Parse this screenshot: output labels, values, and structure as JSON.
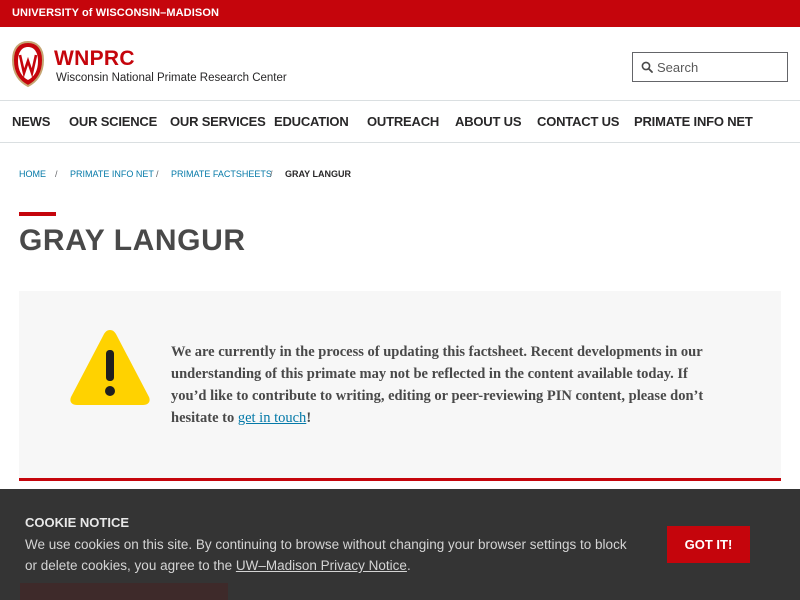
{
  "topbar": {
    "university_label": "UNIVERSITY of WISCONSIN–MADISON"
  },
  "header": {
    "site_acronym": "WNPRC",
    "site_name": "Wisconsin National Primate Research Center",
    "search_placeholder": "Search"
  },
  "nav": {
    "items": [
      {
        "label": "NEWS"
      },
      {
        "label": "OUR SCIENCE"
      },
      {
        "label": "OUR SERVICES"
      },
      {
        "label": "EDUCATION"
      },
      {
        "label": "OUTREACH"
      },
      {
        "label": "ABOUT US"
      },
      {
        "label": "CONTACT US"
      },
      {
        "label": "PRIMATE INFO NET"
      }
    ]
  },
  "breadcrumb": {
    "items": [
      "HOME",
      "PRIMATE INFO NET",
      "PRIMATE FACTSHEETS"
    ],
    "separator": "/",
    "current": "GRAY LANGUR"
  },
  "page": {
    "title": "GRAY LANGUR"
  },
  "notice": {
    "text_before_link": "We are currently in the process of updating this factsheet. Recent developments in our understanding of this primate may not be reflected in the content available today. If you’d like to contribute to writing, editing or peer-reviewing PIN content, please don’t hesitate to ",
    "link_text": "get in touch",
    "text_after_link": "!",
    "icon": "warning-icon"
  },
  "cookie": {
    "title": "COOKIE NOTICE",
    "body_before_link": "We use cookies on this site. By continuing to browse without changing your browser settings to block or delete cookies, you agree to the ",
    "link_text": "UW–Madison Privacy Notice",
    "body_after_link": ".",
    "button_label": "GOT IT!"
  },
  "colors": {
    "brand_red": "#c5050c",
    "link_blue": "#0479a8",
    "warning_yellow": "#ffd200",
    "cookie_bg": "#343434"
  }
}
